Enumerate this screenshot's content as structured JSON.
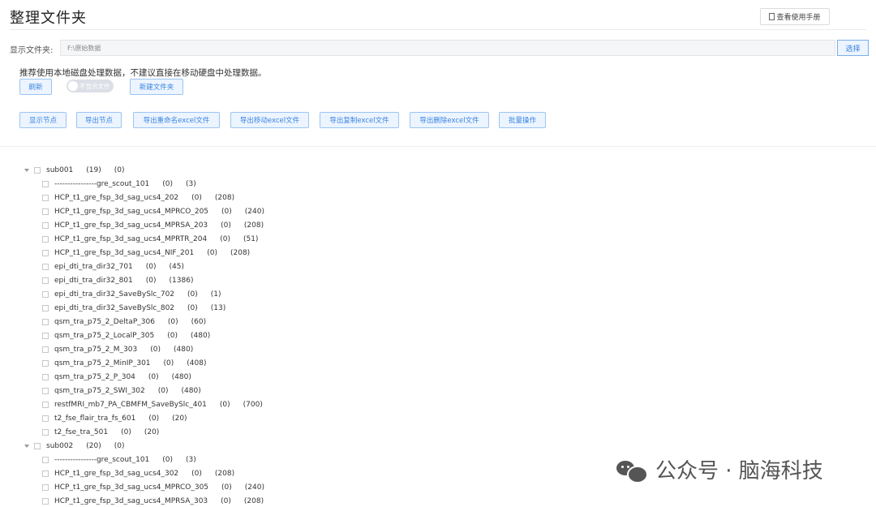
{
  "page_title": "整理文件夹",
  "manual_button": "查看使用手册",
  "folder": {
    "label": "显示文件夹:",
    "value": "F:\\原始数据",
    "select_label": "选择"
  },
  "tip": "推荐使用本地磁盘处理数据，不建议直接在移动硬盘中处理数据。",
  "toolbar1": {
    "refresh": "刷新",
    "toggle_label": "不显示文件",
    "new_folder": "新建文件夹"
  },
  "toolbar2": [
    "显示节点",
    "导出节点",
    "导出重命名excel文件",
    "导出移动excel文件",
    "导出复制excel文件",
    "导出删除excel文件",
    "批量操作"
  ],
  "tree": [
    {
      "name": "sub001",
      "a": "(19)",
      "b": "(0)",
      "level": 0
    },
    {
      "name": "----------------gre_scout_101",
      "a": "(0)",
      "b": "(3)",
      "level": 1
    },
    {
      "name": "HCP_t1_gre_fsp_3d_sag_ucs4_202",
      "a": "(0)",
      "b": "(208)",
      "level": 1
    },
    {
      "name": "HCP_t1_gre_fsp_3d_sag_ucs4_MPRCO_205",
      "a": "(0)",
      "b": "(240)",
      "level": 1
    },
    {
      "name": "HCP_t1_gre_fsp_3d_sag_ucs4_MPRSA_203",
      "a": "(0)",
      "b": "(208)",
      "level": 1
    },
    {
      "name": "HCP_t1_gre_fsp_3d_sag_ucs4_MPRTR_204",
      "a": "(0)",
      "b": "(51)",
      "level": 1
    },
    {
      "name": "HCP_t1_gre_fsp_3d_sag_ucs4_NIF_201",
      "a": "(0)",
      "b": "(208)",
      "level": 1
    },
    {
      "name": "epi_dti_tra_dir32_701",
      "a": "(0)",
      "b": "(45)",
      "level": 1
    },
    {
      "name": "epi_dti_tra_dir32_801",
      "a": "(0)",
      "b": "(1386)",
      "level": 1
    },
    {
      "name": "epi_dti_tra_dir32_SaveBySlc_702",
      "a": "(0)",
      "b": "(1)",
      "level": 1
    },
    {
      "name": "epi_dti_tra_dir32_SaveBySlc_802",
      "a": "(0)",
      "b": "(13)",
      "level": 1
    },
    {
      "name": "qsm_tra_p75_2_DeltaP_306",
      "a": "(0)",
      "b": "(60)",
      "level": 1
    },
    {
      "name": "qsm_tra_p75_2_LocalP_305",
      "a": "(0)",
      "b": "(480)",
      "level": 1
    },
    {
      "name": "qsm_tra_p75_2_M_303",
      "a": "(0)",
      "b": "(480)",
      "level": 1
    },
    {
      "name": "qsm_tra_p75_2_MinIP_301",
      "a": "(0)",
      "b": "(408)",
      "level": 1
    },
    {
      "name": "qsm_tra_p75_2_P_304",
      "a": "(0)",
      "b": "(480)",
      "level": 1
    },
    {
      "name": "qsm_tra_p75_2_SWI_302",
      "a": "(0)",
      "b": "(480)",
      "level": 1
    },
    {
      "name": "restfMRI_mb7_PA_CBMFM_SaveBySlc_401",
      "a": "(0)",
      "b": "(700)",
      "level": 1
    },
    {
      "name": "t2_fse_flair_tra_fs_601",
      "a": "(0)",
      "b": "(20)",
      "level": 1
    },
    {
      "name": "t2_fse_tra_501",
      "a": "(0)",
      "b": "(20)",
      "level": 1
    },
    {
      "name": "sub002",
      "a": "(20)",
      "b": "(0)",
      "level": 0
    },
    {
      "name": "----------------gre_scout_101",
      "a": "(0)",
      "b": "(3)",
      "level": 1
    },
    {
      "name": "HCP_t1_gre_fsp_3d_sag_ucs4_302",
      "a": "(0)",
      "b": "(208)",
      "level": 1
    },
    {
      "name": "HCP_t1_gre_fsp_3d_sag_ucs4_MPRCO_305",
      "a": "(0)",
      "b": "(240)",
      "level": 1
    },
    {
      "name": "HCP_t1_gre_fsp_3d_sag_ucs4_MPRSA_303",
      "a": "(0)",
      "b": "(208)",
      "level": 1
    }
  ],
  "watermark": "公众号 · 脑海科技"
}
